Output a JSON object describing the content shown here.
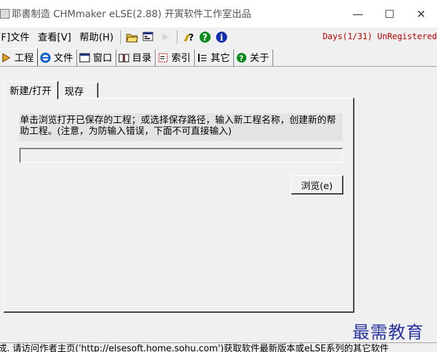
{
  "window": {
    "title": "耶書制造 CHMmaker eLSE(2.88) 开寅软件工作室出品",
    "minimize": "—",
    "maximize": "☐",
    "close": "✕"
  },
  "menu": {
    "items": [
      {
        "label": "[F]文件"
      },
      {
        "label": "查看[V]"
      },
      {
        "label": "帮助(H)"
      }
    ],
    "status": "Days(1/31) UnRegistered"
  },
  "toolbar": {
    "icons": [
      "open-folder-icon",
      "view-icon",
      "play-icon",
      "help-question-icon",
      "green-question-icon",
      "info-icon"
    ]
  },
  "tabs": [
    {
      "label": "工程",
      "icon": "project-icon"
    },
    {
      "label": "文件",
      "icon": "ie-file-icon"
    },
    {
      "label": "窗口",
      "icon": "window-icon"
    },
    {
      "label": "目录",
      "icon": "book-icon"
    },
    {
      "label": "索引",
      "icon": "index-icon"
    },
    {
      "label": "其它",
      "icon": "other-icon"
    },
    {
      "label": "关于",
      "icon": "about-icon"
    }
  ],
  "subtabs": [
    {
      "label": "新建/打开"
    },
    {
      "label": "现存"
    }
  ],
  "panel": {
    "description": "单击浏览打开已保存的工程；或选择保存路径，输入新工程名称，创建新的帮助工程。(注意，为防输入错误，下面不可直接输入)",
    "path_value": "",
    "browse_label": "浏览(e)"
  },
  "watermark": "最需教育",
  "statusbar": {
    "text": "成. 请访问作者主页('http://elsesoft.home.sohu.com')获取软件最新版本或eLSE系列的其它软件"
  },
  "colors": {
    "status_red": "#c00000",
    "watermark_blue": "#2a34a0"
  }
}
